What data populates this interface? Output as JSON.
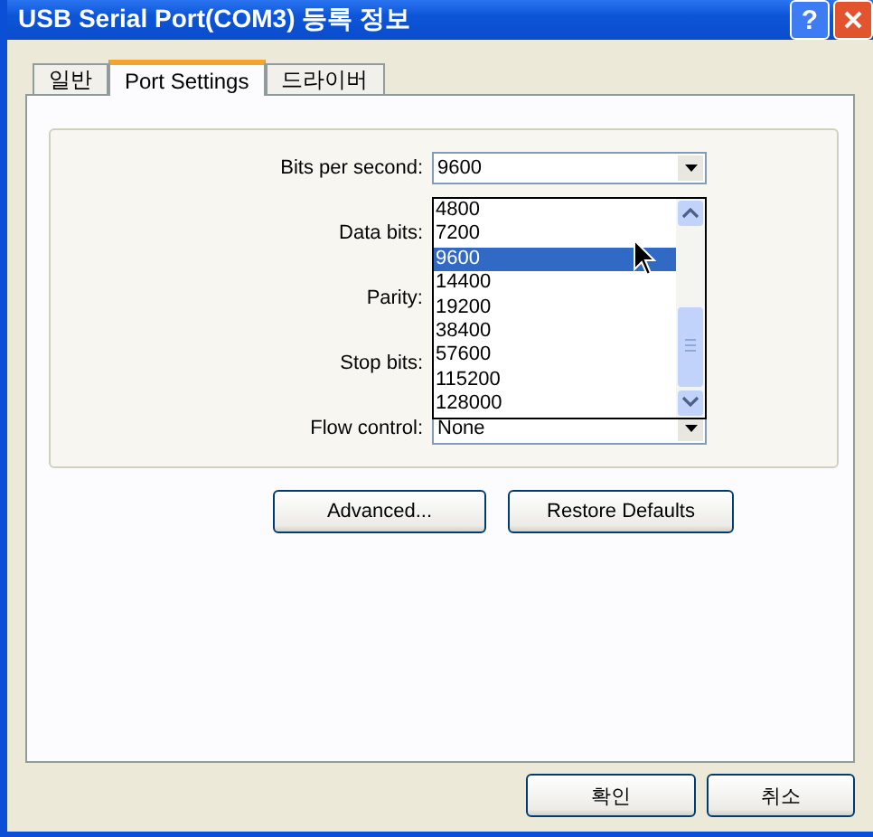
{
  "window": {
    "title": "USB Serial Port(COM3) 등록 정보",
    "help_button": "?"
  },
  "tabs": [
    {
      "label": "일반",
      "selected": false
    },
    {
      "label": "Port Settings",
      "selected": true
    },
    {
      "label": "드라이버",
      "selected": false
    }
  ],
  "settings": [
    {
      "label": "Bits per second:",
      "value": "9600",
      "expanded": true,
      "options": [
        {
          "label": "4800",
          "selected": false
        },
        {
          "label": "7200",
          "selected": false
        },
        {
          "label": "9600",
          "selected": true
        },
        {
          "label": "14400",
          "selected": false
        },
        {
          "label": "19200",
          "selected": false
        },
        {
          "label": "38400",
          "selected": false
        },
        {
          "label": "57600",
          "selected": false
        },
        {
          "label": "115200",
          "selected": false
        },
        {
          "label": "128000",
          "selected": false
        }
      ]
    },
    {
      "label": "Data bits:",
      "expanded": false
    },
    {
      "label": "Parity:",
      "expanded": false
    },
    {
      "label": "Stop bits:",
      "expanded": false
    },
    {
      "label": "Flow control:",
      "value": "None",
      "expanded": false
    }
  ],
  "actions": [
    "Advanced...",
    "Restore Defaults"
  ],
  "buttons": [
    "확인",
    "취소"
  ]
}
